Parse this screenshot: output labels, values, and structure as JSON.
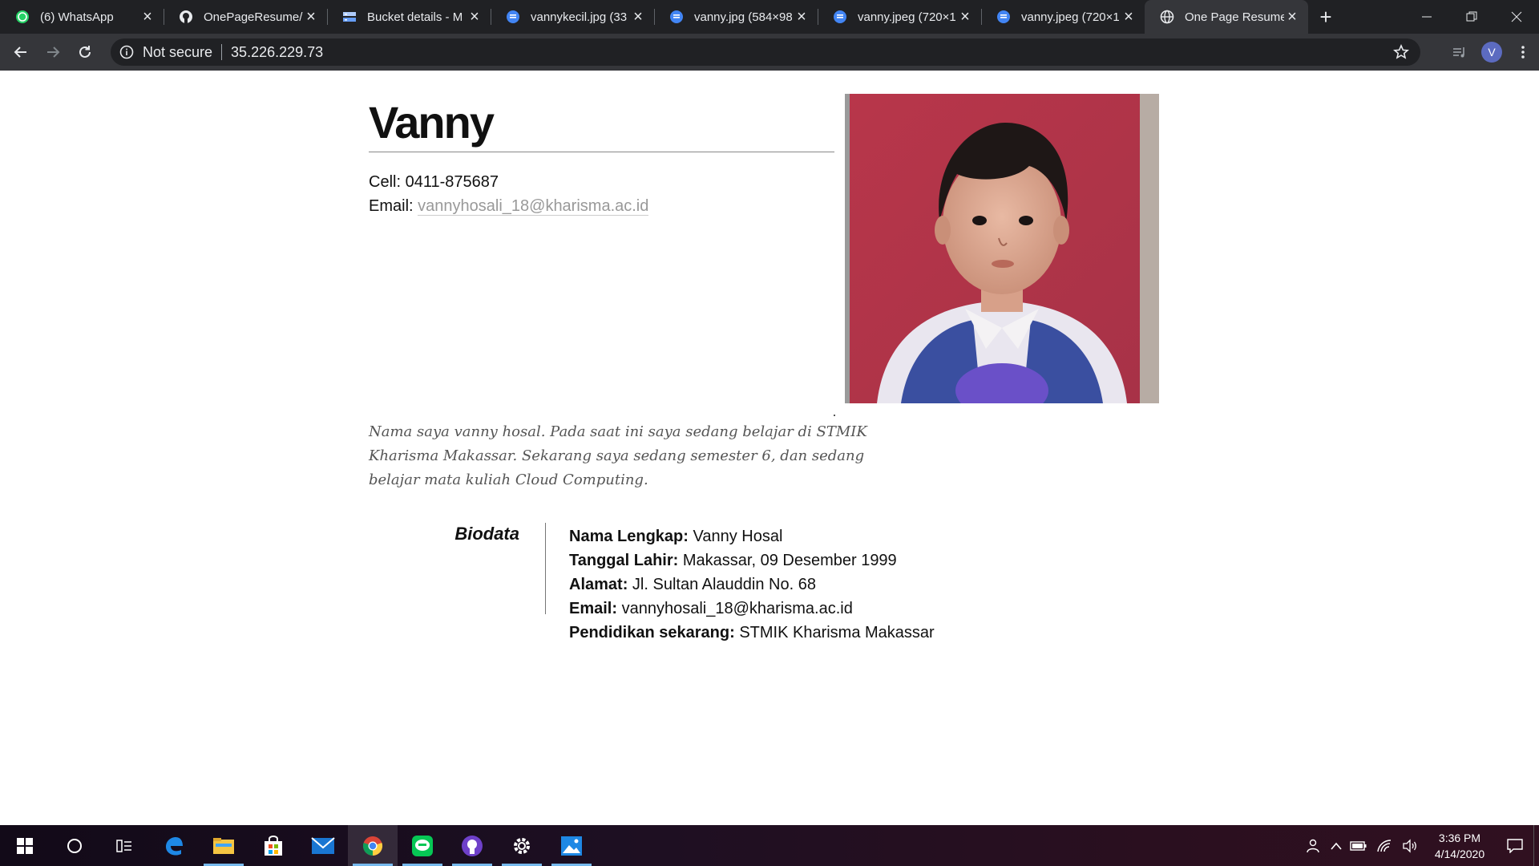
{
  "browser": {
    "tabs": [
      {
        "title": "(6) WhatsApp",
        "icon": "whatsapp-icon",
        "active": false
      },
      {
        "title": "OnePageResume/i",
        "icon": "github-icon",
        "active": false
      },
      {
        "title": "Bucket details - M",
        "icon": "storage-bucket-icon",
        "active": false
      },
      {
        "title": "vannykecil.jpg (33",
        "icon": "google-docs-icon",
        "active": false
      },
      {
        "title": "vanny.jpg (584×98",
        "icon": "google-docs-icon",
        "active": false
      },
      {
        "title": "vanny.jpeg (720×1",
        "icon": "google-docs-icon",
        "active": false
      },
      {
        "title": "vanny.jpeg (720×1",
        "icon": "google-docs-icon",
        "active": false
      },
      {
        "title": "One Page Resume",
        "icon": "globe-icon",
        "active": true
      }
    ],
    "security_label": "Not secure",
    "url": "35.226.229.73",
    "profile_initial": "V"
  },
  "resume": {
    "name": "Vanny",
    "cell_label": "Cell:",
    "cell_value": "0411-875687",
    "email_label": "Email:",
    "email_value": "vannyhosali_18@kharisma.ac.id",
    "intro": "Nama saya vanny hosal. Pada saat ini saya sedang belajar di STMIK Kharisma Makassar. Sekarang saya sedang semester 6, dan sedang belajar mata kuliah Cloud Computing.",
    "biodata_heading": "Biodata",
    "biodata": [
      {
        "label": "Nama Lengkap:",
        "value": "Vanny Hosal"
      },
      {
        "label": "Tanggal Lahir:",
        "value": "Makassar, 09 Desember 1999"
      },
      {
        "label": "Alamat:",
        "value": "Jl. Sultan Alauddin No. 68"
      },
      {
        "label": "Email:",
        "value": "vannyhosali_18@kharisma.ac.id"
      },
      {
        "label": "Pendidikan sekarang:",
        "value": "STMIK Kharisma Makassar"
      }
    ]
  },
  "taskbar": {
    "time": "3:36 PM",
    "date": "4/14/2020"
  },
  "colors": {
    "tab_bar": "#202124",
    "toolbar": "#35363a",
    "link": "#999999",
    "intro_text": "#555555",
    "photo_background": "#b23a4a"
  }
}
